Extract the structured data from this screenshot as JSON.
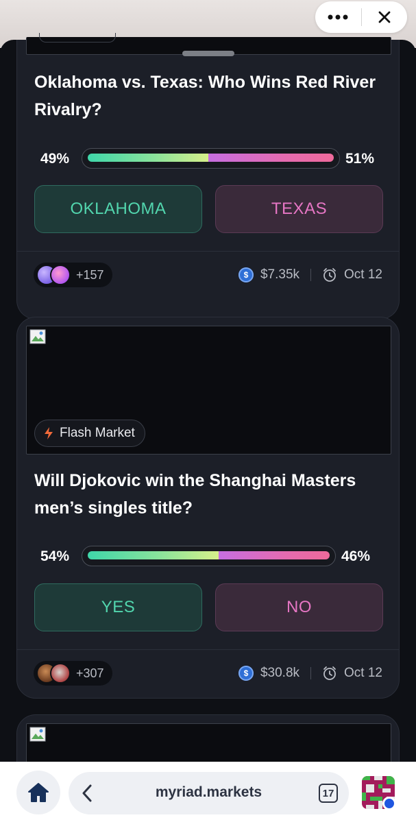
{
  "top_bar": {
    "more_icon": "more-dots-icon",
    "close_icon": "close-icon"
  },
  "markets": [
    {
      "question": "Oklahoma vs. Texas: Who Wins Red River Rivalry?",
      "yes_pct": "49%",
      "no_pct": "51%",
      "yes_fraction": 0.49,
      "no_fraction": 0.51,
      "yes_label": "OKLAHOMA",
      "no_label": "TEXAS",
      "traders": "+157",
      "volume": "$7.35k",
      "end_date": "Oct 12"
    },
    {
      "tag": "Flash Market",
      "question": "Will Djokovic win the Shanghai Masters men’s singles title?",
      "yes_pct": "54%",
      "no_pct": "46%",
      "yes_fraction": 0.54,
      "no_fraction": 0.46,
      "yes_label": "YES",
      "no_label": "NO",
      "traders": "+307",
      "volume": "$30.8k",
      "end_date": "Oct 12"
    }
  ],
  "browser": {
    "url": "myriad.markets",
    "tab_count": "17"
  },
  "colors": {
    "yes_accent": "#52d6ae",
    "no_accent": "#e676c4",
    "card_bg": "#1c1f28",
    "page_bg": "#0e1015"
  }
}
